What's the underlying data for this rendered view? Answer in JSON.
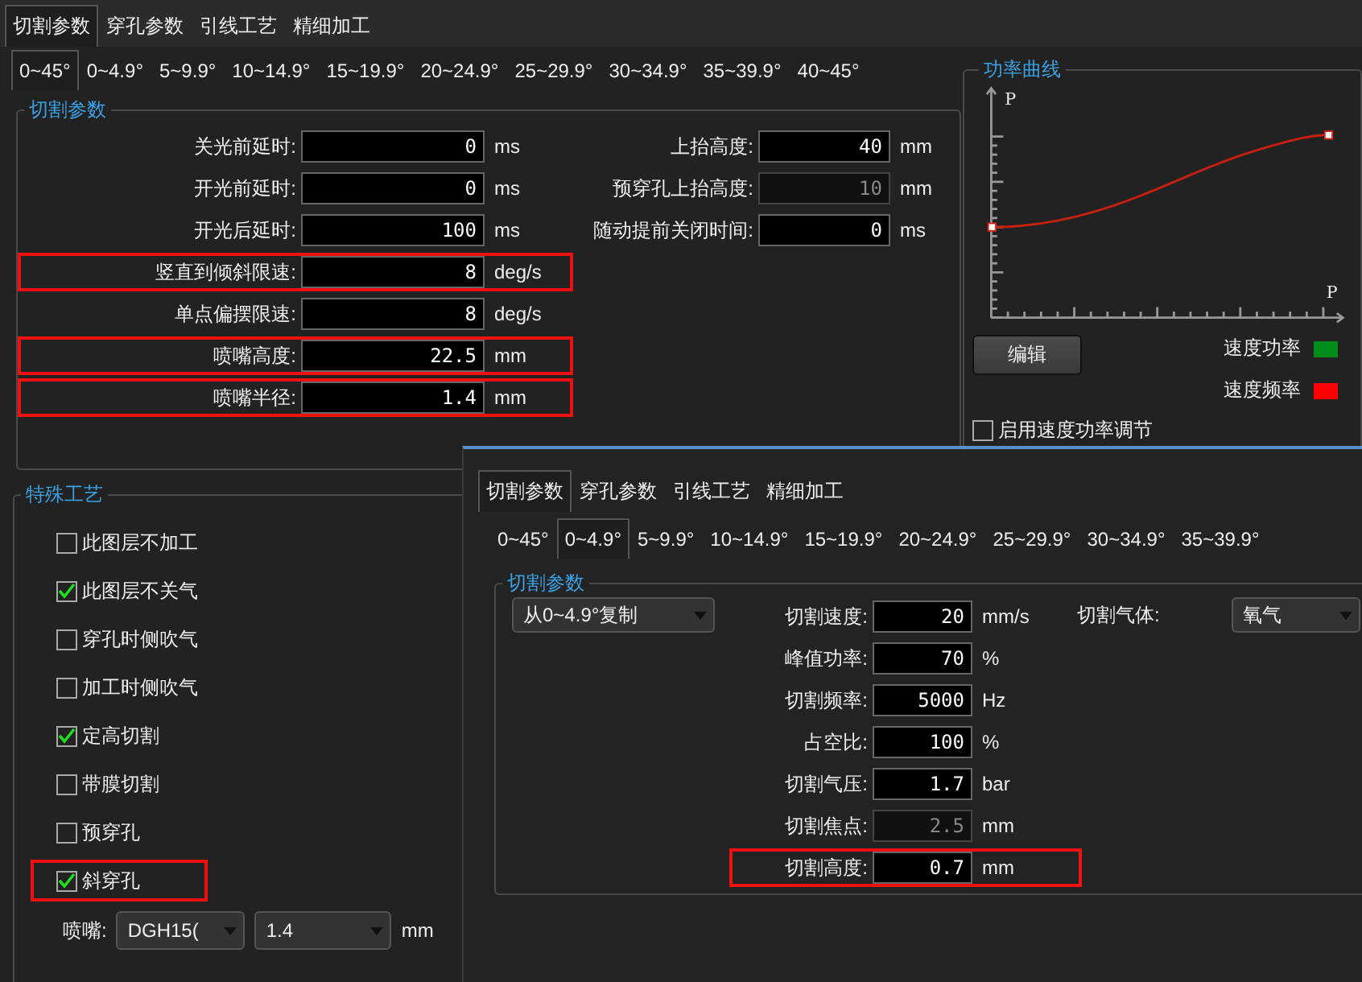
{
  "tabs": [
    {
      "label": "切割参数",
      "selected": true
    },
    {
      "label": "穿孔参数",
      "selected": false
    },
    {
      "label": "引线工艺",
      "selected": false
    },
    {
      "label": "精细加工",
      "selected": false
    }
  ],
  "angle_tabs": [
    {
      "label": "0~45°",
      "selected": true
    },
    {
      "label": "0~4.9°",
      "selected": false
    },
    {
      "label": "5~9.9°",
      "selected": false
    },
    {
      "label": "10~14.9°",
      "selected": false
    },
    {
      "label": "15~19.9°",
      "selected": false
    },
    {
      "label": "20~24.9°",
      "selected": false
    },
    {
      "label": "25~29.9°",
      "selected": false
    },
    {
      "label": "30~34.9°",
      "selected": false
    },
    {
      "label": "35~39.9°",
      "selected": false
    },
    {
      "label": "40~45°",
      "selected": false
    }
  ],
  "cutting_params": {
    "title": "切割参数",
    "left_fields": [
      {
        "label": "关光前延时:",
        "value": "0",
        "unit": "ms",
        "disabled": false,
        "highlighted": false
      },
      {
        "label": "开光前延时:",
        "value": "0",
        "unit": "ms",
        "disabled": false,
        "highlighted": false
      },
      {
        "label": "开光后延时:",
        "value": "100",
        "unit": "ms",
        "disabled": false,
        "highlighted": false
      },
      {
        "label": "竖直到倾斜限速:",
        "value": "8",
        "unit": "deg/s",
        "disabled": false,
        "highlighted": true
      },
      {
        "label": "单点偏摆限速:",
        "value": "8",
        "unit": "deg/s",
        "disabled": false,
        "highlighted": false
      },
      {
        "label": "喷嘴高度:",
        "value": "22.5",
        "unit": "mm",
        "disabled": false,
        "highlighted": true
      },
      {
        "label": "喷嘴半径:",
        "value": "1.4",
        "unit": "mm",
        "disabled": false,
        "highlighted": true
      }
    ],
    "right_fields": [
      {
        "label": "上抬高度:",
        "value": "40",
        "unit": "mm",
        "disabled": false,
        "highlighted": false
      },
      {
        "label": "预穿孔上抬高度:",
        "value": "10",
        "unit": "mm",
        "disabled": true,
        "highlighted": false
      },
      {
        "label": "随动提前关闭时间:",
        "value": "0",
        "unit": "ms",
        "disabled": false,
        "highlighted": false
      }
    ]
  },
  "power_curve": {
    "title": "功率曲线",
    "y_axis_label": "P",
    "x_axis_label": "P",
    "edit_button": "编辑",
    "legend": [
      {
        "label": "速度功率",
        "color": "#008c1a"
      },
      {
        "label": "速度频率",
        "color": "#ff0000"
      }
    ],
    "checkboxes": [
      {
        "label": "启用速度功率调节",
        "checked": false
      }
    ]
  },
  "special_process": {
    "title": "特殊工艺",
    "options": [
      {
        "label": "此图层不加工",
        "checked": false,
        "highlighted": false
      },
      {
        "label": "此图层不关气",
        "checked": true,
        "highlighted": false
      },
      {
        "label": "穿孔时侧吹气",
        "checked": false,
        "highlighted": false
      },
      {
        "label": "加工时侧吹气",
        "checked": false,
        "highlighted": false
      },
      {
        "label": "定高切割",
        "checked": true,
        "highlighted": false
      },
      {
        "label": "带膜切割",
        "checked": false,
        "highlighted": false
      },
      {
        "label": "预穿孔",
        "checked": false,
        "highlighted": false
      },
      {
        "label": "斜穿孔",
        "checked": true,
        "highlighted": true
      }
    ],
    "nozzle": {
      "label": "喷嘴:",
      "type": "DGH15(",
      "size": "1.4",
      "unit": "mm"
    }
  },
  "overlay_window": {
    "tabs": [
      {
        "label": "切割参数",
        "selected": true
      },
      {
        "label": "穿孔参数",
        "selected": false
      },
      {
        "label": "引线工艺",
        "selected": false
      },
      {
        "label": "精细加工",
        "selected": false
      }
    ],
    "angle_tabs": [
      {
        "label": "0~45°",
        "selected": false
      },
      {
        "label": "0~4.9°",
        "selected": true
      },
      {
        "label": "5~9.9°",
        "selected": false
      },
      {
        "label": "10~14.9°",
        "selected": false
      },
      {
        "label": "15~19.9°",
        "selected": false
      },
      {
        "label": "20~24.9°",
        "selected": false
      },
      {
        "label": "25~29.9°",
        "selected": false
      },
      {
        "label": "30~34.9°",
        "selected": false
      },
      {
        "label": "35~39.9°",
        "selected": false
      }
    ],
    "group": {
      "title": "切割参数",
      "copy_dropdown": "从0~4.9°复制",
      "fields": [
        {
          "label": "切割速度:",
          "value": "20",
          "unit": "mm/s",
          "disabled": false,
          "highlighted": false
        },
        {
          "label": "峰值功率:",
          "value": "70",
          "unit": "%",
          "disabled": false,
          "highlighted": false
        },
        {
          "label": "切割频率:",
          "value": "5000",
          "unit": "Hz",
          "disabled": false,
          "highlighted": false
        },
        {
          "label": "占空比:",
          "value": "100",
          "unit": "%",
          "disabled": false,
          "highlighted": false
        },
        {
          "label": "切割气压:",
          "value": "1.7",
          "unit": "bar",
          "disabled": false,
          "highlighted": false
        },
        {
          "label": "切割焦点:",
          "value": "2.5",
          "unit": "mm",
          "disabled": true,
          "highlighted": false
        },
        {
          "label": "切割高度:",
          "value": "0.7",
          "unit": "mm",
          "disabled": false,
          "highlighted": true
        }
      ],
      "gas": {
        "label": "切割气体:",
        "value": "氧气"
      }
    }
  }
}
